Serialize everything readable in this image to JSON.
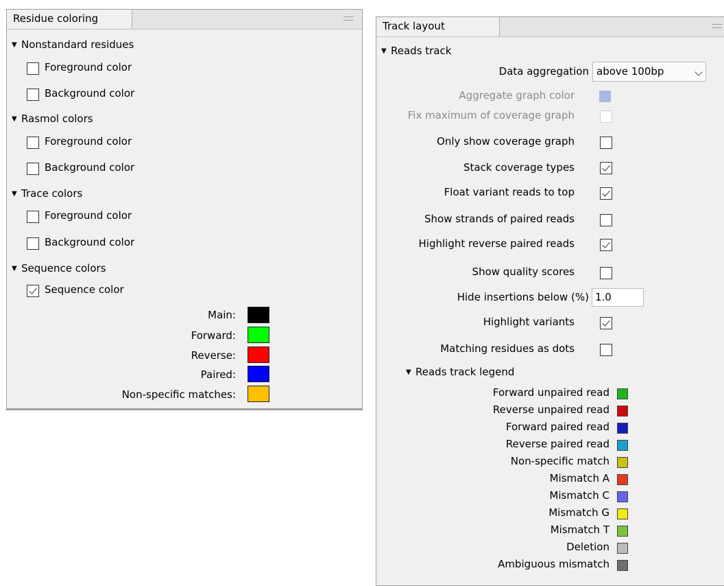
{
  "residue_panel": {
    "title": "Residue coloring",
    "sections": [
      {
        "label": "Nonstandard residues",
        "options": [
          {
            "label": "Foreground color",
            "checked": false
          },
          {
            "label": "Background color",
            "checked": false
          }
        ]
      },
      {
        "label": "Rasmol colors",
        "options": [
          {
            "label": "Foreground color",
            "checked": false
          },
          {
            "label": "Background color",
            "checked": false
          }
        ]
      },
      {
        "label": "Trace colors",
        "options": [
          {
            "label": "Foreground color",
            "checked": false
          },
          {
            "label": "Background color",
            "checked": false
          }
        ]
      },
      {
        "label": "Sequence colors",
        "options": [
          {
            "label": "Sequence color",
            "checked": true
          }
        ]
      }
    ],
    "colors": [
      {
        "label": "Main:",
        "color": "#000000"
      },
      {
        "label": "Forward:",
        "color": "#00ff00"
      },
      {
        "label": "Reverse:",
        "color": "#ff0000"
      },
      {
        "label": "Paired:",
        "color": "#0000ff"
      },
      {
        "label": "Non-specific matches:",
        "color": "#ffc000"
      }
    ]
  },
  "track_panel": {
    "title": "Track layout",
    "section": "Reads track",
    "data_aggregation": {
      "label": "Data aggregation",
      "value": "above 100bp"
    },
    "aggregate_graph_color": {
      "label": "Aggregate graph color",
      "color": "#a9b9e3",
      "disabled": true
    },
    "options": [
      {
        "label": "Fix maximum of coverage graph",
        "checked": false,
        "disabled": true
      },
      {
        "label": "Only show coverage graph",
        "checked": false
      },
      {
        "label": "Stack coverage types",
        "checked": true
      },
      {
        "label": "Float variant reads to top",
        "checked": true
      },
      {
        "label": "Show strands of paired reads",
        "checked": false
      },
      {
        "label": "Highlight reverse paired reads",
        "checked": true
      },
      {
        "label": "Show quality scores",
        "checked": false
      }
    ],
    "hide_insertions": {
      "label": "Hide insertions below (%)",
      "value": "1.0"
    },
    "options2": [
      {
        "label": "Highlight variants",
        "checked": true
      },
      {
        "label": "Matching residues as dots",
        "checked": false
      }
    ],
    "legend_title": "Reads track legend",
    "legend": [
      {
        "label": "Forward unpaired read",
        "color": "#1fb71f"
      },
      {
        "label": "Reverse unpaired read",
        "color": "#cc0a0a"
      },
      {
        "label": "Forward paired read",
        "color": "#1020b8"
      },
      {
        "label": "Reverse paired read",
        "color": "#1aa0cc"
      },
      {
        "label": "Non-specific match",
        "color": "#c9c010"
      },
      {
        "label": "Mismatch A",
        "color": "#e43a22"
      },
      {
        "label": "Mismatch C",
        "color": "#6565e8"
      },
      {
        "label": "Mismatch G",
        "color": "#f2ea12"
      },
      {
        "label": "Mismatch T",
        "color": "#79c43a"
      },
      {
        "label": "Deletion",
        "color": "#bcbcbc"
      },
      {
        "label": "Ambiguous mismatch",
        "color": "#6e6e6e"
      }
    ]
  }
}
